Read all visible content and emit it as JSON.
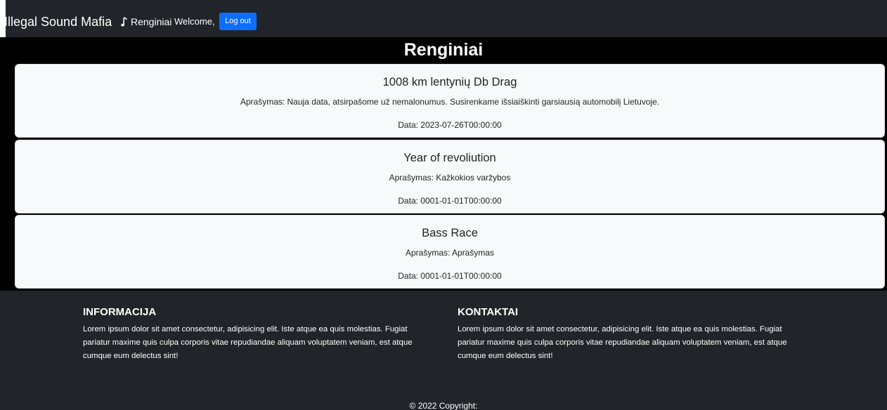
{
  "header": {
    "brand": "Illegal Sound Mafia",
    "nav_link": "Renginiai",
    "nav_icon": "music-note-icon",
    "welcome": "Welcome,",
    "logout_label": "Log out",
    "accent_color": "#0d6efd"
  },
  "page_title": "Renginiai",
  "events": [
    {
      "title": "1008 km lentynių Db Drag",
      "description": "Aprašymas: Nauja data, atsirpašome už nemalonumus. Susirenkame išsiaiškinti garsiausią automobilį Lietuvoje.",
      "date": "Data: 2023-07-26T00:00:00"
    },
    {
      "title": "Year of revoliution",
      "description": "Aprašymas: Kažkokios varžybos",
      "date": "Data: 0001-01-01T00:00:00"
    },
    {
      "title": "Bass Race",
      "description": "Aprašymas: Aprašymas",
      "date": "Data: 0001-01-01T00:00:00"
    }
  ],
  "footer": {
    "info": {
      "heading": "INFORMACIJA",
      "text": "Lorem ipsum dolor sit amet consectetur, adipisicing elit. Iste atque ea quis molestias. Fugiat pariatur maxime quis culpa corporis vitae repudiandae aliquam voluptatem veniam, est atque cumque eum delectus sint!"
    },
    "contacts": {
      "heading": "KONTAKTAI",
      "text": "Lorem ipsum dolor sit amet consectetur, adipisicing elit. Iste atque ea quis molestias. Fugiat pariatur maxime quis culpa corporis vitae repudiandae aliquam voluptatem veniam, est atque cumque eum delectus sint!"
    },
    "copyright": "© 2022 Copyright:"
  }
}
